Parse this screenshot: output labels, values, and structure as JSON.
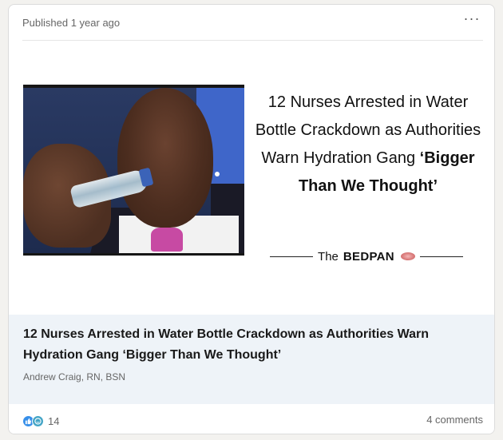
{
  "post": {
    "published": "Published 1 year ago",
    "more_icon": "more-horizontal-icon"
  },
  "article_image": {
    "headline_plain": "12 Nurses Arrested in Water Bottle Crackdown as Authorities Warn Hydration Gang",
    "headline_bold": "‘Bigger Than We Thought’",
    "brand_prefix": "The",
    "brand_name": "BEDPAN"
  },
  "article": {
    "title": "12 Nurses Arrested in Water Bottle Crackdown as Authorities Warn Hydration Gang ‘Bigger Than We Thought’",
    "author": "Andrew Craig, RN, BSN"
  },
  "social": {
    "reaction_icons": [
      "like-icon",
      "support-icon"
    ],
    "reaction_count": "14",
    "comments": "4 comments"
  },
  "colors": {
    "like": "#378fe9",
    "support": "#44a5c6",
    "caption_bg": "#eef3f8"
  }
}
